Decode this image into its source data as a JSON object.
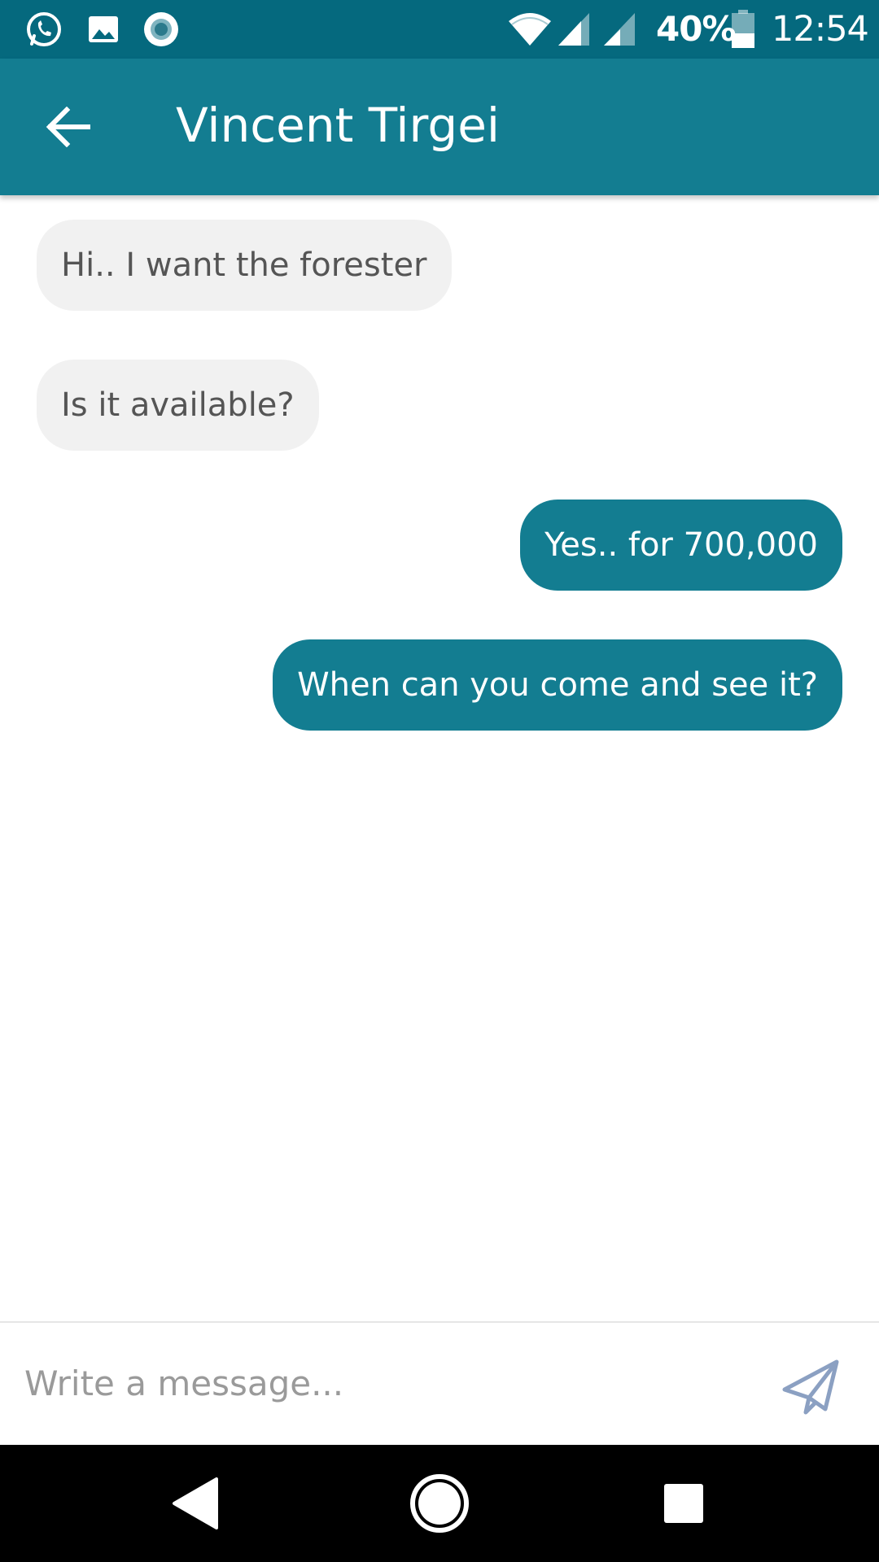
{
  "status_bar": {
    "notification_icons": [
      "whatsapp-icon",
      "image-icon",
      "record-icon"
    ],
    "battery_percent": "40%",
    "battery_level": 0.4,
    "time": "12:54",
    "background_color": "#05697e"
  },
  "toolbar": {
    "back_icon": "arrow-left-icon",
    "title": "Vincent Tirgei",
    "background_color": "#137d91"
  },
  "messages": [
    {
      "direction": "incoming",
      "text": "Hi.. I want the forester"
    },
    {
      "direction": "incoming",
      "text": "Is it available?"
    },
    {
      "direction": "outgoing",
      "text": "Yes.. for 700,000"
    },
    {
      "direction": "outgoing",
      "text": "When can you come and see it?"
    }
  ],
  "composer": {
    "placeholder": "Write a message...",
    "value": "",
    "send_icon": "paper-plane-icon"
  },
  "nav_bar": {
    "buttons": [
      "back-triangle-icon",
      "home-circle-icon",
      "recents-square-icon"
    ]
  },
  "colors": {
    "accent": "#137d91",
    "incoming_bubble": "#f1f1f1",
    "incoming_text": "#555555",
    "outgoing_text": "#ffffff"
  }
}
